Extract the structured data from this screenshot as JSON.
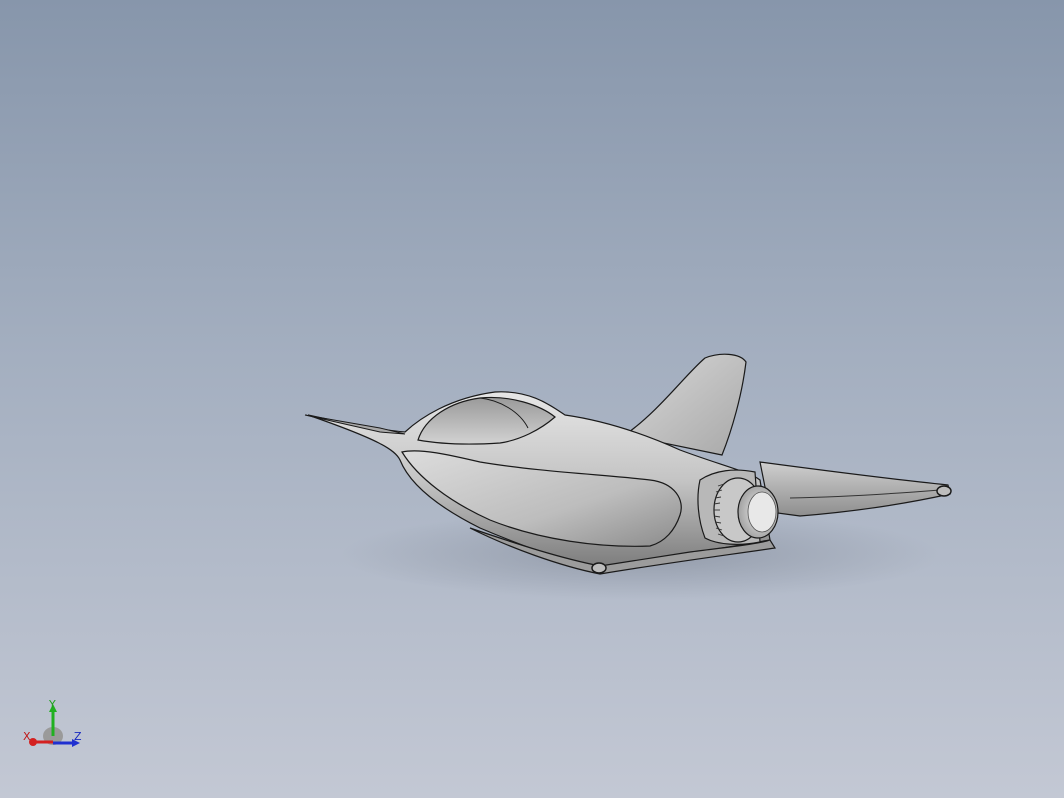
{
  "viewport": {
    "background_top": "#8796ab",
    "background_bottom": "#c3c8d4"
  },
  "model": {
    "description_icon": "aircraft-3d-model",
    "shading_color": "#c9c9c9",
    "edge_color": "#1a1a1a"
  },
  "triad": {
    "x_label": "X",
    "y_label": "Y",
    "z_label": "Z",
    "x_color": "#d42020",
    "y_color": "#20b020",
    "z_color": "#2030d0"
  }
}
